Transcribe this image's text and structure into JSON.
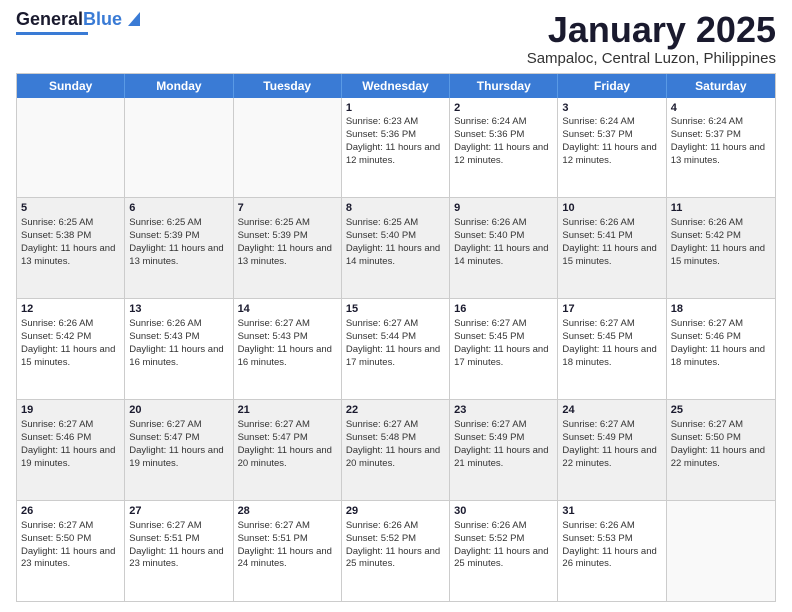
{
  "logo": {
    "line1": "General",
    "line2": "Blue"
  },
  "title": "January 2025",
  "location": "Sampaloc, Central Luzon, Philippines",
  "days": [
    "Sunday",
    "Monday",
    "Tuesday",
    "Wednesday",
    "Thursday",
    "Friday",
    "Saturday"
  ],
  "weeks": [
    [
      {
        "day": "",
        "text": "",
        "empty": true
      },
      {
        "day": "",
        "text": "",
        "empty": true
      },
      {
        "day": "",
        "text": "",
        "empty": true
      },
      {
        "day": "1",
        "sunrise": "6:23 AM",
        "sunset": "5:36 PM",
        "daylight": "11 hours and 12 minutes."
      },
      {
        "day": "2",
        "sunrise": "6:24 AM",
        "sunset": "5:36 PM",
        "daylight": "11 hours and 12 minutes."
      },
      {
        "day": "3",
        "sunrise": "6:24 AM",
        "sunset": "5:37 PM",
        "daylight": "11 hours and 12 minutes."
      },
      {
        "day": "4",
        "sunrise": "6:24 AM",
        "sunset": "5:37 PM",
        "daylight": "11 hours and 13 minutes."
      }
    ],
    [
      {
        "day": "5",
        "sunrise": "6:25 AM",
        "sunset": "5:38 PM",
        "daylight": "11 hours and 13 minutes."
      },
      {
        "day": "6",
        "sunrise": "6:25 AM",
        "sunset": "5:39 PM",
        "daylight": "11 hours and 13 minutes."
      },
      {
        "day": "7",
        "sunrise": "6:25 AM",
        "sunset": "5:39 PM",
        "daylight": "11 hours and 13 minutes."
      },
      {
        "day": "8",
        "sunrise": "6:25 AM",
        "sunset": "5:40 PM",
        "daylight": "11 hours and 14 minutes."
      },
      {
        "day": "9",
        "sunrise": "6:26 AM",
        "sunset": "5:40 PM",
        "daylight": "11 hours and 14 minutes."
      },
      {
        "day": "10",
        "sunrise": "6:26 AM",
        "sunset": "5:41 PM",
        "daylight": "11 hours and 15 minutes."
      },
      {
        "day": "11",
        "sunrise": "6:26 AM",
        "sunset": "5:42 PM",
        "daylight": "11 hours and 15 minutes."
      }
    ],
    [
      {
        "day": "12",
        "sunrise": "6:26 AM",
        "sunset": "5:42 PM",
        "daylight": "11 hours and 15 minutes."
      },
      {
        "day": "13",
        "sunrise": "6:26 AM",
        "sunset": "5:43 PM",
        "daylight": "11 hours and 16 minutes."
      },
      {
        "day": "14",
        "sunrise": "6:27 AM",
        "sunset": "5:43 PM",
        "daylight": "11 hours and 16 minutes."
      },
      {
        "day": "15",
        "sunrise": "6:27 AM",
        "sunset": "5:44 PM",
        "daylight": "11 hours and 17 minutes."
      },
      {
        "day": "16",
        "sunrise": "6:27 AM",
        "sunset": "5:45 PM",
        "daylight": "11 hours and 17 minutes."
      },
      {
        "day": "17",
        "sunrise": "6:27 AM",
        "sunset": "5:45 PM",
        "daylight": "11 hours and 18 minutes."
      },
      {
        "day": "18",
        "sunrise": "6:27 AM",
        "sunset": "5:46 PM",
        "daylight": "11 hours and 18 minutes."
      }
    ],
    [
      {
        "day": "19",
        "sunrise": "6:27 AM",
        "sunset": "5:46 PM",
        "daylight": "11 hours and 19 minutes."
      },
      {
        "day": "20",
        "sunrise": "6:27 AM",
        "sunset": "5:47 PM",
        "daylight": "11 hours and 19 minutes."
      },
      {
        "day": "21",
        "sunrise": "6:27 AM",
        "sunset": "5:47 PM",
        "daylight": "11 hours and 20 minutes."
      },
      {
        "day": "22",
        "sunrise": "6:27 AM",
        "sunset": "5:48 PM",
        "daylight": "11 hours and 20 minutes."
      },
      {
        "day": "23",
        "sunrise": "6:27 AM",
        "sunset": "5:49 PM",
        "daylight": "11 hours and 21 minutes."
      },
      {
        "day": "24",
        "sunrise": "6:27 AM",
        "sunset": "5:49 PM",
        "daylight": "11 hours and 22 minutes."
      },
      {
        "day": "25",
        "sunrise": "6:27 AM",
        "sunset": "5:50 PM",
        "daylight": "11 hours and 22 minutes."
      }
    ],
    [
      {
        "day": "26",
        "sunrise": "6:27 AM",
        "sunset": "5:50 PM",
        "daylight": "11 hours and 23 minutes."
      },
      {
        "day": "27",
        "sunrise": "6:27 AM",
        "sunset": "5:51 PM",
        "daylight": "11 hours and 23 minutes."
      },
      {
        "day": "28",
        "sunrise": "6:27 AM",
        "sunset": "5:51 PM",
        "daylight": "11 hours and 24 minutes."
      },
      {
        "day": "29",
        "sunrise": "6:26 AM",
        "sunset": "5:52 PM",
        "daylight": "11 hours and 25 minutes."
      },
      {
        "day": "30",
        "sunrise": "6:26 AM",
        "sunset": "5:52 PM",
        "daylight": "11 hours and 25 minutes."
      },
      {
        "day": "31",
        "sunrise": "6:26 AM",
        "sunset": "5:53 PM",
        "daylight": "11 hours and 26 minutes."
      },
      {
        "day": "",
        "text": "",
        "empty": true
      }
    ]
  ],
  "labels": {
    "sunrise": "Sunrise:",
    "sunset": "Sunset:",
    "daylight": "Daylight:"
  }
}
